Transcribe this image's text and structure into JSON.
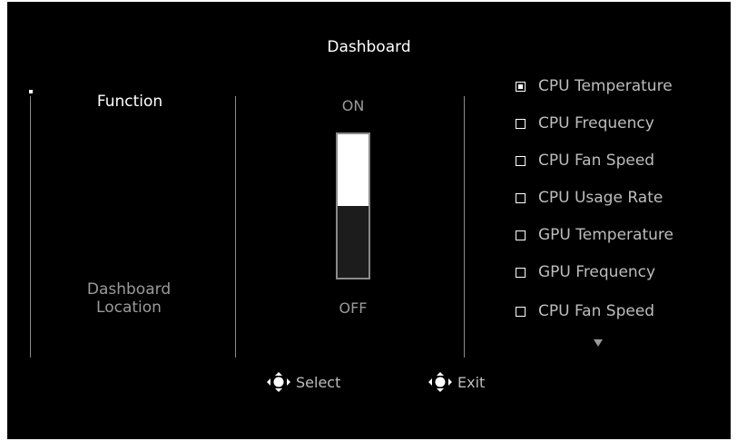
{
  "title": "Dashboard",
  "menu": {
    "items": [
      {
        "label": "Function",
        "selected": true
      },
      {
        "label": "Dashboard Location",
        "selected": false
      }
    ]
  },
  "toggle": {
    "on_label": "ON",
    "off_label": "OFF",
    "value": "ON",
    "fill_fraction": 0.5
  },
  "options": {
    "items": [
      {
        "label": "CPU Temperature",
        "checked": true
      },
      {
        "label": "CPU Frequency",
        "checked": false
      },
      {
        "label": "CPU Fan Speed",
        "checked": false
      },
      {
        "label": "CPU Usage Rate",
        "checked": false
      },
      {
        "label": "GPU Temperature",
        "checked": false
      },
      {
        "label": "GPU Frequency",
        "checked": false
      },
      {
        "label": "CPU Fan Speed",
        "checked": false
      }
    ],
    "more_indicator": "scroll-down-arrow-icon"
  },
  "hints": {
    "select_label": "Select",
    "exit_label": "Exit",
    "icon": "joystick-icon"
  },
  "colors": {
    "background": "#000000",
    "text_primary": "#ffffff",
    "text_dim": "#9a9a9a",
    "accent": "#ffffff"
  }
}
